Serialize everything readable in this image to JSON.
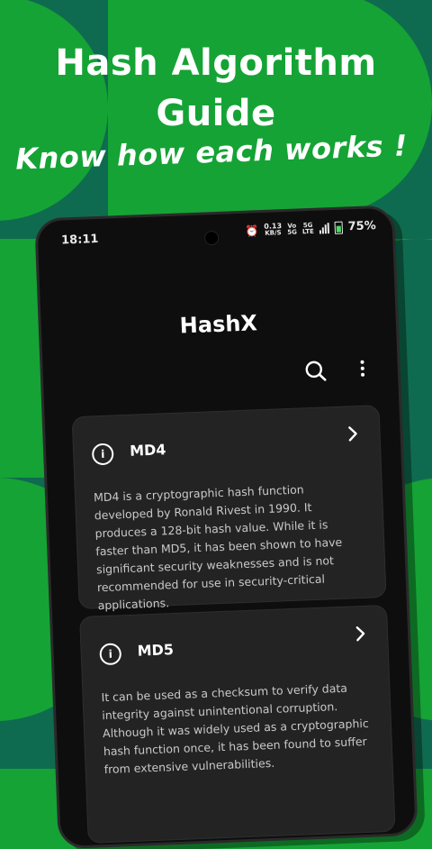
{
  "promo": {
    "headline_line1": "Hash Algorithm",
    "headline_line2": "Guide",
    "tagline": "Know how each works !"
  },
  "status_bar": {
    "time": "18:11",
    "alarm_icon": "alarm-icon",
    "net_speed_value": "0.13",
    "net_speed_unit": "KB/S",
    "volte_top": "Vo",
    "volte_bottom": "5G",
    "network_top": "5G",
    "network_bottom": "LTE",
    "battery_percent": "75%"
  },
  "app": {
    "title": "HashX",
    "search_icon": "search-icon",
    "more_icon": "more-vertical-icon"
  },
  "algorithms": [
    {
      "name": "MD4",
      "description": "MD4 is a cryptographic hash function developed by Ronald Rivest in 1990. It produces a 128-bit hash value. While it is faster than MD5, it has been shown to have significant security weaknesses and is not recommended for use in security-critical applications."
    },
    {
      "name": "MD5",
      "description": "It can be used as a checksum to verify data integrity against unintentional corruption. Although it was widely used as a cryptographic hash function once, it has been found to suffer from extensive vulnerabilities."
    }
  ],
  "colors": {
    "background_green": "#15a335",
    "pattern_dark": "#0f6b4f",
    "phone_body": "#0e0e0e",
    "card_bg": "#232323",
    "battery_green": "#4cd964"
  }
}
